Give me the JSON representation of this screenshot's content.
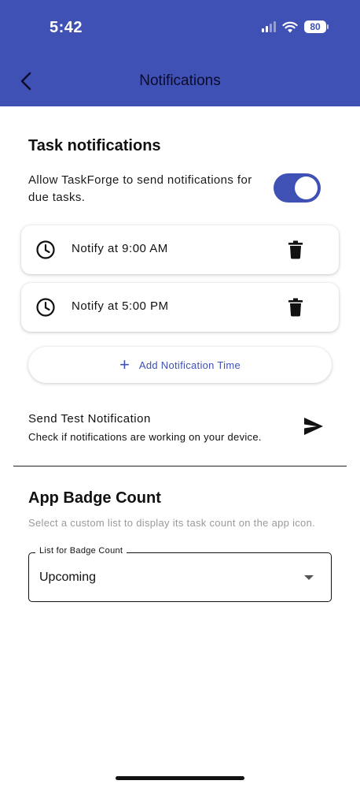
{
  "status_bar": {
    "time": "5:42",
    "battery": "80"
  },
  "nav": {
    "title": "Notifications"
  },
  "task_notifications": {
    "title": "Task notifications",
    "allow_text": "Allow TaskForge to send notifications for due tasks.",
    "enabled": true,
    "times": [
      {
        "label": "Notify at 9:00 AM"
      },
      {
        "label": "Notify at 5:00 PM"
      }
    ],
    "add_label": "Add Notification Time",
    "add_icon": "+"
  },
  "test_notification": {
    "title": "Send Test Notification",
    "subtitle": "Check if notifications are working on your device."
  },
  "badge": {
    "title": "App Badge Count",
    "description": "Select a custom list to display its task count on the app icon.",
    "select_label": "List for Badge Count",
    "select_value": "Upcoming"
  },
  "colors": {
    "primary": "#3f51b5",
    "header_bg": "#3f51b5"
  },
  "icons": {
    "back": "chevron-left-icon",
    "clock": "clock-icon",
    "trash": "trash-icon",
    "send": "send-icon",
    "dropdown": "caret-down-icon"
  }
}
